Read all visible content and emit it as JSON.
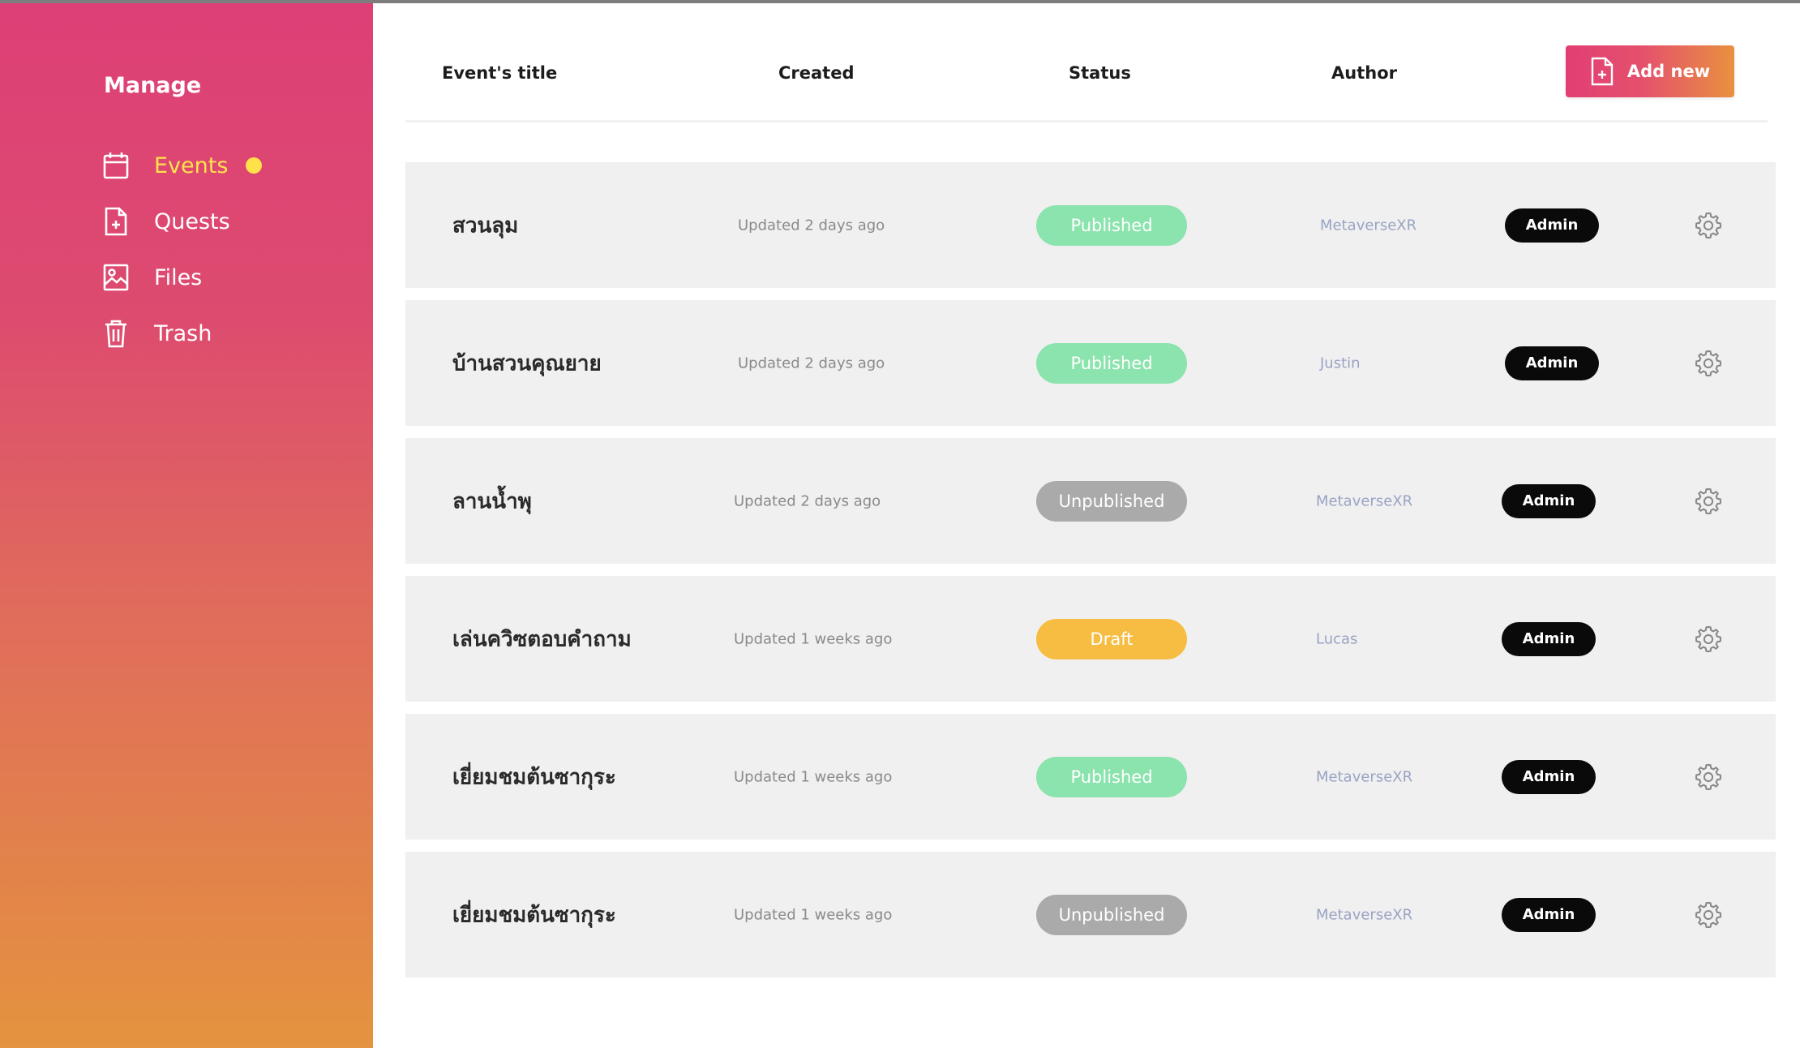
{
  "sidebar": {
    "title": "Manage",
    "items": [
      {
        "label": "Events",
        "icon": "calendar-icon",
        "active": true
      },
      {
        "label": "Quests",
        "icon": "document-icon",
        "active": false
      },
      {
        "label": "Files",
        "icon": "image-icon",
        "active": false
      },
      {
        "label": "Trash",
        "icon": "trash-icon",
        "active": false
      }
    ]
  },
  "table": {
    "headers": {
      "title": "Event's title",
      "created": "Created",
      "status": "Status",
      "author": "Author"
    },
    "add_button": "Add new",
    "rows": [
      {
        "title": "สวนลุม",
        "created": "Updated 2 days ago",
        "status": "Published",
        "author": "MetaverseXR",
        "role": "Admin"
      },
      {
        "title": "บ้านสวนคุณยาย",
        "created": "Updated 2 days ago",
        "status": "Published",
        "author": "Justin",
        "role": "Admin"
      },
      {
        "title": "ลานน้ำพุ",
        "created": "Updated 2 days ago",
        "status": "Unpublished",
        "author": "MetaverseXR",
        "role": "Admin"
      },
      {
        "title": "เล่นควิซตอบคำถาม",
        "created": "Updated 1 weeks ago",
        "status": "Draft",
        "author": "Lucas",
        "role": "Admin"
      },
      {
        "title": "เยี่ยมชมต้นซากุระ",
        "created": "Updated 1 weeks ago",
        "status": "Published",
        "author": "MetaverseXR",
        "role": "Admin"
      },
      {
        "title": "เยี่ยมชมต้นซากุระ",
        "created": "Updated 1 weeks ago",
        "status": "Unpublished",
        "author": "MetaverseXR",
        "role": "Admin"
      }
    ]
  },
  "colors": {
    "sidebar_top": "#dd3f76",
    "sidebar_bottom": "#e4933f",
    "active_accent": "#ffe24a",
    "published": "#8be3ad",
    "unpublished": "#aaaaaa",
    "draft": "#f6bd42",
    "badge": "#0a0a0a"
  }
}
